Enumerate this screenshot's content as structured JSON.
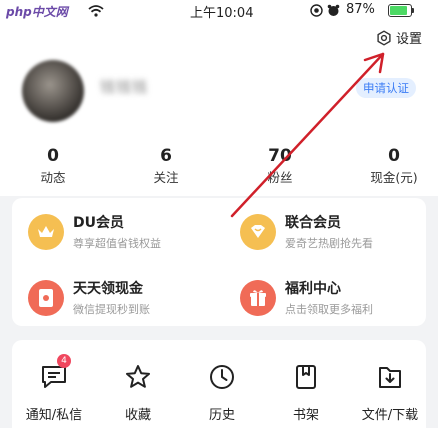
{
  "status_bar": {
    "site_label": "php中文网",
    "time": "上午10:04",
    "battery_percent": "87%",
    "battery_level": 0.87
  },
  "header": {
    "settings_label": "设置",
    "username": "钱钱钱",
    "verify_label": "申请认证",
    "stats": [
      {
        "value": "0",
        "label": "动态"
      },
      {
        "value": "6",
        "label": "关注"
      },
      {
        "value": "70",
        "label": "粉丝"
      },
      {
        "value": "0",
        "label": "现金(元)"
      }
    ]
  },
  "services": [
    {
      "title": "DU会员",
      "subtitle": "尊享超值省钱权益",
      "icon": "crown-icon",
      "color": "#f0b84a"
    },
    {
      "title": "联合会员",
      "subtitle": "爱奇艺热剧抢先看",
      "icon": "heart-gem-icon",
      "color": "#f0b84a"
    },
    {
      "title": "天天领现金",
      "subtitle": "微信提现秒到账",
      "icon": "red-envelope-icon",
      "color": "#ef6a56"
    },
    {
      "title": "福利中心",
      "subtitle": "点击领取更多福利",
      "icon": "gift-icon",
      "color": "#ef6a56"
    }
  ],
  "tools": [
    {
      "label": "通知/私信",
      "icon": "message-icon",
      "badge": "4"
    },
    {
      "label": "收藏",
      "icon": "star-icon"
    },
    {
      "label": "历史",
      "icon": "clock-icon"
    },
    {
      "label": "书架",
      "icon": "bookshelf-icon"
    },
    {
      "label": "文件/下载",
      "icon": "download-folder-icon"
    }
  ],
  "colors": {
    "accent_blue": "#3b7cf5",
    "annotation_red": "#d0202a",
    "badge_red": "#f0475e"
  }
}
